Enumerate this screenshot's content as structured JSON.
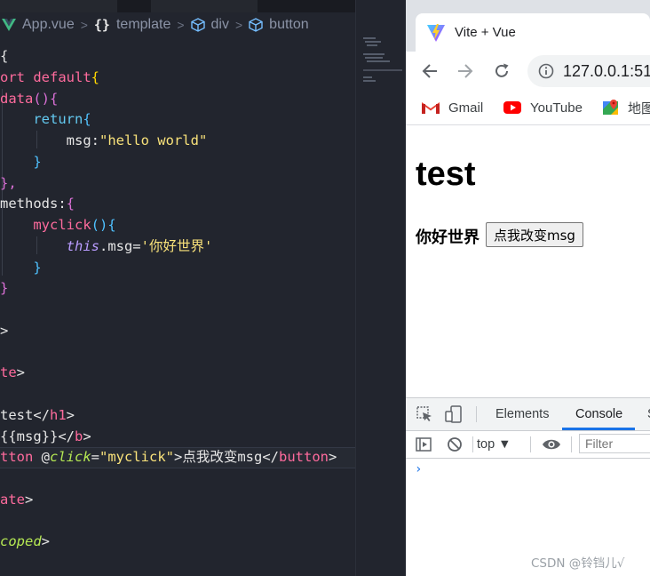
{
  "editor": {
    "breadcrumb": {
      "file": "App.vue",
      "curly": "{}",
      "template": "template",
      "div": "div",
      "button": "button"
    },
    "lines": [
      {
        "parts": [
          {
            "c": "plain",
            "t": "{"
          }
        ]
      },
      {
        "parts": [
          {
            "c": "kw",
            "t": "ort default"
          },
          {
            "c": "br1",
            "t": "{"
          }
        ]
      },
      {
        "parts": [
          {
            "c": "fn2",
            "t": "data"
          },
          {
            "c": "br2",
            "t": "()"
          },
          {
            "c": "br2",
            "t": "{"
          }
        ]
      },
      {
        "parts": [
          {
            "c": "plain",
            "t": "    "
          },
          {
            "c": "ret",
            "t": "return"
          },
          {
            "c": "br3",
            "t": "{"
          }
        ]
      },
      {
        "parts": [
          {
            "c": "plain",
            "t": "        msg:"
          },
          {
            "c": "str",
            "t": "\"hello world\""
          }
        ]
      },
      {
        "parts": [
          {
            "c": "plain",
            "t": "    "
          },
          {
            "c": "br3",
            "t": "}"
          }
        ]
      },
      {
        "parts": [
          {
            "c": "br2",
            "t": "},"
          }
        ]
      },
      {
        "parts": [
          {
            "c": "plain",
            "t": "methods:"
          },
          {
            "c": "br2",
            "t": "{"
          }
        ]
      },
      {
        "parts": [
          {
            "c": "plain",
            "t": "    "
          },
          {
            "c": "fn2",
            "t": "myclick"
          },
          {
            "c": "br3",
            "t": "()"
          },
          {
            "c": "br3",
            "t": "{"
          }
        ]
      },
      {
        "parts": [
          {
            "c": "plain",
            "t": "        "
          },
          {
            "c": "thiskw",
            "t": "this"
          },
          {
            "c": "plain",
            "t": ".msg="
          },
          {
            "c": "str",
            "t": "'你好世界'"
          }
        ]
      },
      {
        "parts": [
          {
            "c": "plain",
            "t": "    "
          },
          {
            "c": "br3",
            "t": "}"
          }
        ]
      },
      {
        "parts": [
          {
            "c": "br2",
            "t": "}"
          }
        ]
      },
      {
        "parts": []
      },
      {
        "parts": [
          {
            "c": "plain",
            "t": ">"
          }
        ]
      },
      {
        "parts": []
      },
      {
        "parts": [
          {
            "c": "tag",
            "t": "te"
          },
          {
            "c": "punc",
            "t": ">"
          }
        ]
      },
      {
        "parts": []
      },
      {
        "parts": [
          {
            "c": "plain",
            "t": "test</"
          },
          {
            "c": "tag",
            "t": "h1"
          },
          {
            "c": "punc",
            "t": ">"
          }
        ]
      },
      {
        "parts": [
          {
            "c": "plain",
            "t": "{{msg}}</"
          },
          {
            "c": "tag",
            "t": "b"
          },
          {
            "c": "punc",
            "t": ">"
          }
        ]
      },
      {
        "parts": [
          {
            "c": "tag",
            "t": "tton"
          },
          {
            "c": "plain",
            "t": " @"
          },
          {
            "c": "attr",
            "t": "click"
          },
          {
            "c": "plain",
            "t": "="
          },
          {
            "c": "str",
            "t": "\"myclick\""
          },
          {
            "c": "plain",
            "t": ">点我改变msg</"
          },
          {
            "c": "tag",
            "t": "button"
          },
          {
            "c": "punc",
            "t": ">"
          }
        ],
        "active": true
      },
      {
        "parts": []
      },
      {
        "parts": [
          {
            "c": "tag",
            "t": "ate"
          },
          {
            "c": "punc",
            "t": ">"
          }
        ]
      },
      {
        "parts": []
      },
      {
        "parts": [
          {
            "c": "scoped",
            "t": "coped"
          },
          {
            "c": "punc",
            "t": ">"
          }
        ]
      },
      {
        "parts": [
          {
            "c": "plain",
            "t": ""
          }
        ]
      }
    ]
  },
  "browser": {
    "tab_title": "Vite + Vue",
    "url": "127.0.0.1:51",
    "bookmarks": [
      "Gmail",
      "YouTube",
      "地图"
    ],
    "page": {
      "heading": "test",
      "bold_text": "你好世界",
      "button_label": "点我改变msg"
    },
    "devtools": {
      "tabs": [
        "Elements",
        "Console",
        "S"
      ],
      "active_tab": "Console",
      "context": "top ▼",
      "filter_placeholder": "Filter",
      "prompt": "›"
    }
  },
  "watermark": "CSDN @铃铛儿√"
}
